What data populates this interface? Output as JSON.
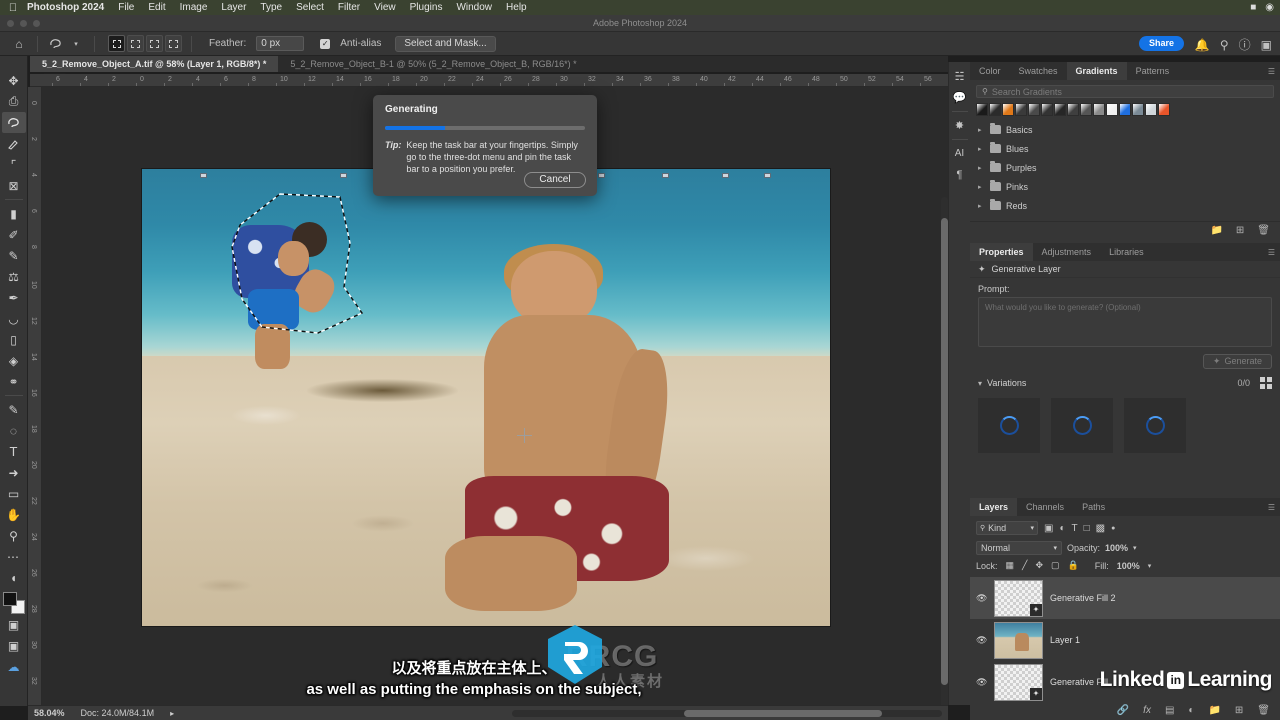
{
  "macmenu": {
    "apple_icon": "apple-logo",
    "app_name": "Photoshop 2024",
    "items": [
      "File",
      "Edit",
      "Image",
      "Layer",
      "Type",
      "Select",
      "Filter",
      "View",
      "Plugins",
      "Window",
      "Help"
    ],
    "right_icons": [
      "battery-icon",
      "control-center-icon"
    ]
  },
  "titlebar": {
    "title": "Adobe Photoshop 2024"
  },
  "options": {
    "home_icon": "home-icon",
    "lasso_icon": "lasso-tool-icon",
    "chevron": "chevron-down-icon",
    "mode_icons": [
      "new-selection-icon",
      "add-to-selection-icon",
      "subtract-from-selection-icon",
      "intersect-selection-icon"
    ],
    "feather_label": "Feather:",
    "feather_value": "0 px",
    "antialias_label": "Anti-alias",
    "select_and_mask": "Select and Mask...",
    "share_label": "Share",
    "right_icons": [
      "bell-icon",
      "search-icon",
      "help-icon",
      "workspace-icon"
    ]
  },
  "tabs": [
    {
      "label": "5_2_Remove_Object_A.tif @ 58% (Layer 1, RGB/8*) *",
      "active": true
    },
    {
      "label": "5_2_Remove_Object_B-1 @ 50% (5_2_Remove_Object_B, RGB/16*) *",
      "active": false
    }
  ],
  "toolbar": {
    "tools": [
      {
        "name": "move-tool-icon",
        "glyph": "✥",
        "active": false
      },
      {
        "name": "rectangular-marquee-tool-icon",
        "glyph": "⬚",
        "active": false
      },
      {
        "name": "lasso-tool-icon",
        "glyph": "🪢",
        "active": true
      },
      {
        "name": "object-selection-tool-icon",
        "glyph": "🖌",
        "active": false
      },
      {
        "name": "crop-tool-icon",
        "glyph": "⌗",
        "active": false
      },
      {
        "name": "frame-tool-icon",
        "glyph": "⊠",
        "active": false
      },
      {
        "name": "eyedropper-tool-icon",
        "glyph": "▬",
        "active": false
      },
      {
        "name": "spot-healing-brush-tool-icon",
        "glyph": "✎",
        "active": false
      },
      {
        "name": "brush-tool-icon",
        "glyph": "✏",
        "active": false
      },
      {
        "name": "clone-stamp-tool-icon",
        "glyph": "⚒",
        "active": false
      },
      {
        "name": "history-brush-tool-icon",
        "glyph": "🖋",
        "active": false
      },
      {
        "name": "eraser-tool-icon",
        "glyph": "◨",
        "active": false
      },
      {
        "name": "gradient-tool-icon",
        "glyph": "▤",
        "active": false
      },
      {
        "name": "blur-tool-icon",
        "glyph": "💧",
        "active": false
      },
      {
        "name": "dodge-tool-icon",
        "glyph": "🔦",
        "active": false
      },
      {
        "name": "pen-tool-icon",
        "glyph": "✒",
        "active": false
      },
      {
        "name": "path-selection-tool-icon",
        "glyph": "◌",
        "active": false
      },
      {
        "name": "type-tool-icon",
        "glyph": "T",
        "active": false
      },
      {
        "name": "direct-selection-tool-icon",
        "glyph": "➤",
        "active": false
      },
      {
        "name": "shape-tool-icon",
        "glyph": "▭",
        "active": false
      },
      {
        "name": "hand-tool-icon",
        "glyph": "✋",
        "active": false
      },
      {
        "name": "zoom-tool-icon",
        "glyph": "🔍",
        "active": false
      },
      {
        "name": "edit-toolbar-icon",
        "glyph": "•••",
        "active": false
      }
    ],
    "quickmask_icon": "quick-mask-icon",
    "screenmode_icon": "screen-mode-icon",
    "cloud_icon": "cloud-documents-icon"
  },
  "rulers": {
    "horizontal_ticks": [
      "6",
      "4",
      "2",
      "0",
      "2",
      "4",
      "6",
      "8",
      "10",
      "12",
      "14",
      "16",
      "18",
      "20",
      "22",
      "24",
      "26",
      "28",
      "30",
      "32",
      "34",
      "36",
      "38",
      "40",
      "42",
      "44",
      "46",
      "48",
      "50",
      "52",
      "54",
      "56"
    ],
    "vertical_ticks": [
      "0",
      "2",
      "4",
      "6",
      "8",
      "10",
      "12",
      "14",
      "16",
      "18",
      "20",
      "22",
      "24",
      "26",
      "28",
      "30",
      "32"
    ]
  },
  "generating_dialog": {
    "title": "Generating",
    "progress_percent": 30,
    "tip_word": "Tip:",
    "tip_text": "Keep the task bar at your fingertips. Simply go to the three-dot menu and pin the task bar to a position you prefer.",
    "cancel_label": "Cancel",
    "accent_color": "#1473e6"
  },
  "rail_icons": [
    "libraries-icon",
    "comments-icon",
    "adjustments-icon",
    "ai-icon",
    "paragraph-icon"
  ],
  "gradients_panel": {
    "tabs": [
      {
        "label": "Color",
        "active": false
      },
      {
        "label": "Swatches",
        "active": false
      },
      {
        "label": "Gradients",
        "active": true
      },
      {
        "label": "Patterns",
        "active": false
      }
    ],
    "menu_icon": "panel-menu-icon",
    "search_icon": "search-icon",
    "search_placeholder": "Search Gradients",
    "swatch_colors": [
      "#1a1a1a",
      "#2b2b2b",
      "#e07818",
      "#3a3a3a",
      "#4a4a4a",
      "#333333",
      "#262626",
      "#3f3f3f",
      "#555555",
      "#8a8a8a",
      "#f0f0f0",
      "#1f6fe0",
      "#7a8a96",
      "#d0d6da",
      "#e8552a"
    ],
    "folders": [
      "Basics",
      "Blues",
      "Purples",
      "Pinks",
      "Reds"
    ],
    "folder_icon": "folder-icon",
    "chevron_icon": "chevron-right-icon",
    "footer_icons": [
      "new-group-icon",
      "new-gradient-icon",
      "delete-icon"
    ]
  },
  "properties_panel": {
    "tabs": [
      {
        "label": "Properties",
        "active": true
      },
      {
        "label": "Adjustments",
        "active": false
      },
      {
        "label": "Libraries",
        "active": false
      }
    ],
    "menu_icon": "panel-menu-icon",
    "layer_type_icon": "generative-layer-icon",
    "layer_type_label": "Generative Layer",
    "prompt_label": "Prompt:",
    "prompt_value": "",
    "prompt_placeholder": "What would you like to generate? (Optional)",
    "generate_label": "Generate",
    "generate_icon": "generate-icon",
    "variations_label": "Variations",
    "variations_chevron": "chevron-down-icon",
    "variations_count": "0/0",
    "grid_view_icon": "grid-view-icon",
    "variation_cells": [
      "loading-spinner",
      "loading-spinner",
      "loading-spinner"
    ]
  },
  "layers_panel": {
    "tabs": [
      {
        "label": "Layers",
        "active": true
      },
      {
        "label": "Channels",
        "active": false
      },
      {
        "label": "Paths",
        "active": false
      }
    ],
    "menu_icon": "panel-menu-icon",
    "filter_kind_label": "Kind",
    "filter_search_icon": "search-icon",
    "filter_icons": [
      "filter-pixel-icon",
      "filter-adjustment-icon",
      "filter-type-icon",
      "filter-shape-icon",
      "filter-smart-object-icon",
      "filter-toggle-icon"
    ],
    "blend_mode": "Normal",
    "opacity_label": "Opacity:",
    "opacity_value": "100%",
    "lock_label": "Lock:",
    "lock_icons": [
      "lock-transparent-icon",
      "lock-image-icon",
      "lock-position-icon",
      "lock-artboard-icon",
      "lock-all-icon"
    ],
    "fill_label": "Fill:",
    "fill_value": "100%",
    "layers": [
      {
        "name": "Generative Fill 2",
        "visible": true,
        "selected": true,
        "thumb": "checker",
        "badge": "generative-badge-icon"
      },
      {
        "name": "Layer 1",
        "visible": true,
        "selected": false,
        "thumb": "photo",
        "badge": ""
      },
      {
        "name": "Generative Fill",
        "visible": true,
        "selected": false,
        "thumb": "checker",
        "badge": "generative-badge-icon"
      }
    ],
    "footer_icons": [
      "link-layers-icon",
      "layer-style-icon",
      "layer-mask-icon",
      "adjustment-layer-icon",
      "new-group-icon",
      "new-layer-icon",
      "delete-layer-icon"
    ]
  },
  "statusbar": {
    "zoom_level": "58.04%",
    "doc_info": "Doc: 24.0M/84.1M",
    "expand_icon": "chevron-right-icon"
  },
  "subtitles": {
    "chinese": "以及将重点放在主体上、",
    "english": "as well as putting the emphasis on the subject,"
  },
  "watermarks": {
    "rrcg": "RRCG",
    "cn": "人人素材",
    "linkedin_text": "Linked",
    "linkedin_in": "in",
    "linkedin_learning": "Learning"
  }
}
